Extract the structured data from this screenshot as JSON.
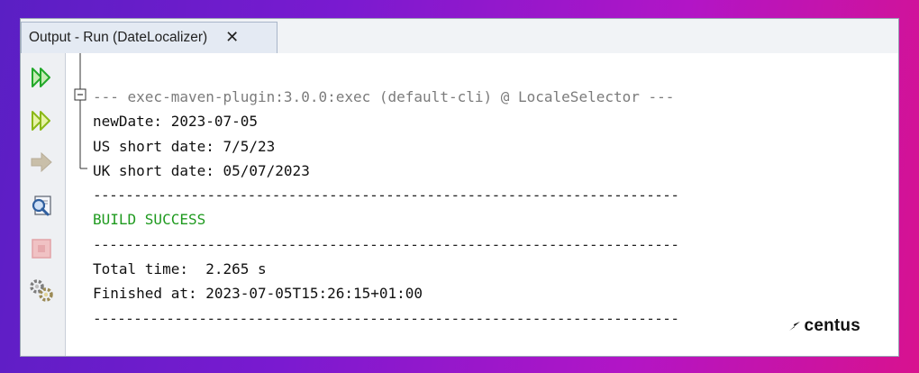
{
  "window": {
    "tab_title": "Output - Run (DateLocalizer)",
    "tab_close": "✕"
  },
  "toolbar": {
    "items": [
      {
        "icon": "rerun-icon",
        "color": "#22a82a"
      },
      {
        "icon": "rerun-with-options-icon",
        "color": "#8ab817"
      },
      {
        "icon": "arrow-right-icon",
        "color": "#b8ad98"
      },
      {
        "icon": "find-in-output-icon",
        "color": "#3a6fc0"
      },
      {
        "icon": "stop-icon",
        "color": "#e2a3a7"
      },
      {
        "icon": "settings-icon",
        "color": "#8a8a8a"
      }
    ]
  },
  "output": {
    "lines": [
      {
        "text": "--- exec-maven-plugin:3.0.0:exec (default-cli) @ LocaleSelector ---",
        "style": "grey"
      },
      {
        "text": "newDate: 2023-07-05",
        "style": "normal"
      },
      {
        "text": "US short date: 7/5/23",
        "style": "normal"
      },
      {
        "text": "UK short date: 05/07/2023",
        "style": "normal"
      },
      {
        "text": "------------------------------------------------------------------------",
        "style": "rule"
      },
      {
        "text": "BUILD SUCCESS",
        "style": "green"
      },
      {
        "text": "------------------------------------------------------------------------",
        "style": "rule"
      },
      {
        "text": "Total time:  2.265 s",
        "style": "normal"
      },
      {
        "text": "Finished at: 2023-07-05T15:26:15+01:00",
        "style": "normal"
      },
      {
        "text": "------------------------------------------------------------------------",
        "style": "rule"
      }
    ]
  },
  "brand": {
    "logo_text": "centus"
  },
  "colors": {
    "success_green": "#1f9a1f",
    "header_grey": "#7b7b7b"
  }
}
